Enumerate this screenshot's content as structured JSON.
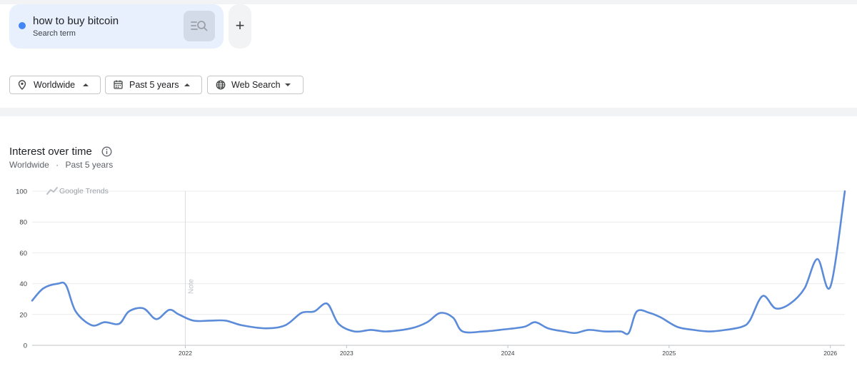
{
  "search_term": {
    "name": "how to buy bitcoin",
    "type_label": "Search term",
    "color": "#4285f4"
  },
  "add_button": {
    "label": "+"
  },
  "filters": [
    {
      "icon": "location-pin-icon",
      "label": "Worldwide"
    },
    {
      "icon": "calendar-icon",
      "label": "Past 5 years"
    },
    {
      "icon": "globe-icon",
      "label": "Web Search"
    }
  ],
  "section": {
    "title": "Interest over time",
    "subtitle_region": "Worldwide",
    "subtitle_sep": "·",
    "subtitle_period": "Past 5 years"
  },
  "chart_data": {
    "type": "line",
    "watermark": "Google Trends",
    "note_label": "Note",
    "note_x": 2022.0,
    "xlim": [
      2021.05,
      2026.09
    ],
    "ylim": [
      0,
      100
    ],
    "yticks": [
      0,
      20,
      40,
      60,
      80,
      100
    ],
    "xticks": [
      {
        "value": 2022,
        "label": "2022"
      },
      {
        "value": 2023,
        "label": "2023"
      },
      {
        "value": 2024,
        "label": "2024"
      },
      {
        "value": 2025,
        "label": "2025"
      },
      {
        "value": 2026,
        "label": "2026"
      }
    ],
    "grid": true,
    "series": [
      {
        "color": "#5b8bd9",
        "points": [
          [
            2021.05,
            29
          ],
          [
            2021.12,
            37
          ],
          [
            2021.21,
            40
          ],
          [
            2021.26,
            39
          ],
          [
            2021.32,
            22
          ],
          [
            2021.42,
            13
          ],
          [
            2021.5,
            15
          ],
          [
            2021.59,
            14
          ],
          [
            2021.65,
            22
          ],
          [
            2021.74,
            24
          ],
          [
            2021.82,
            17
          ],
          [
            2021.9,
            23
          ],
          [
            2021.96,
            20
          ],
          [
            2022.05,
            16
          ],
          [
            2022.15,
            16
          ],
          [
            2022.25,
            16
          ],
          [
            2022.35,
            13
          ],
          [
            2022.5,
            11
          ],
          [
            2022.62,
            13
          ],
          [
            2022.72,
            21
          ],
          [
            2022.8,
            22
          ],
          [
            2022.88,
            27
          ],
          [
            2022.95,
            14
          ],
          [
            2023.05,
            9
          ],
          [
            2023.15,
            10
          ],
          [
            2023.25,
            9
          ],
          [
            2023.4,
            11
          ],
          [
            2023.5,
            15
          ],
          [
            2023.58,
            21
          ],
          [
            2023.66,
            18
          ],
          [
            2023.72,
            9
          ],
          [
            2023.85,
            9
          ],
          [
            2023.95,
            10
          ],
          [
            2024.1,
            12
          ],
          [
            2024.17,
            15
          ],
          [
            2024.25,
            11
          ],
          [
            2024.35,
            9
          ],
          [
            2024.42,
            8
          ],
          [
            2024.5,
            10
          ],
          [
            2024.6,
            9
          ],
          [
            2024.7,
            9
          ],
          [
            2024.75,
            8
          ],
          [
            2024.8,
            22
          ],
          [
            2024.88,
            21
          ],
          [
            2024.95,
            18
          ],
          [
            2025.05,
            12
          ],
          [
            2025.15,
            10
          ],
          [
            2025.25,
            9
          ],
          [
            2025.35,
            10
          ],
          [
            2025.45,
            12
          ],
          [
            2025.5,
            16
          ],
          [
            2025.58,
            32
          ],
          [
            2025.66,
            24
          ],
          [
            2025.75,
            27
          ],
          [
            2025.84,
            37
          ],
          [
            2025.92,
            56
          ],
          [
            2026.0,
            38
          ],
          [
            2026.09,
            100
          ]
        ]
      }
    ]
  }
}
